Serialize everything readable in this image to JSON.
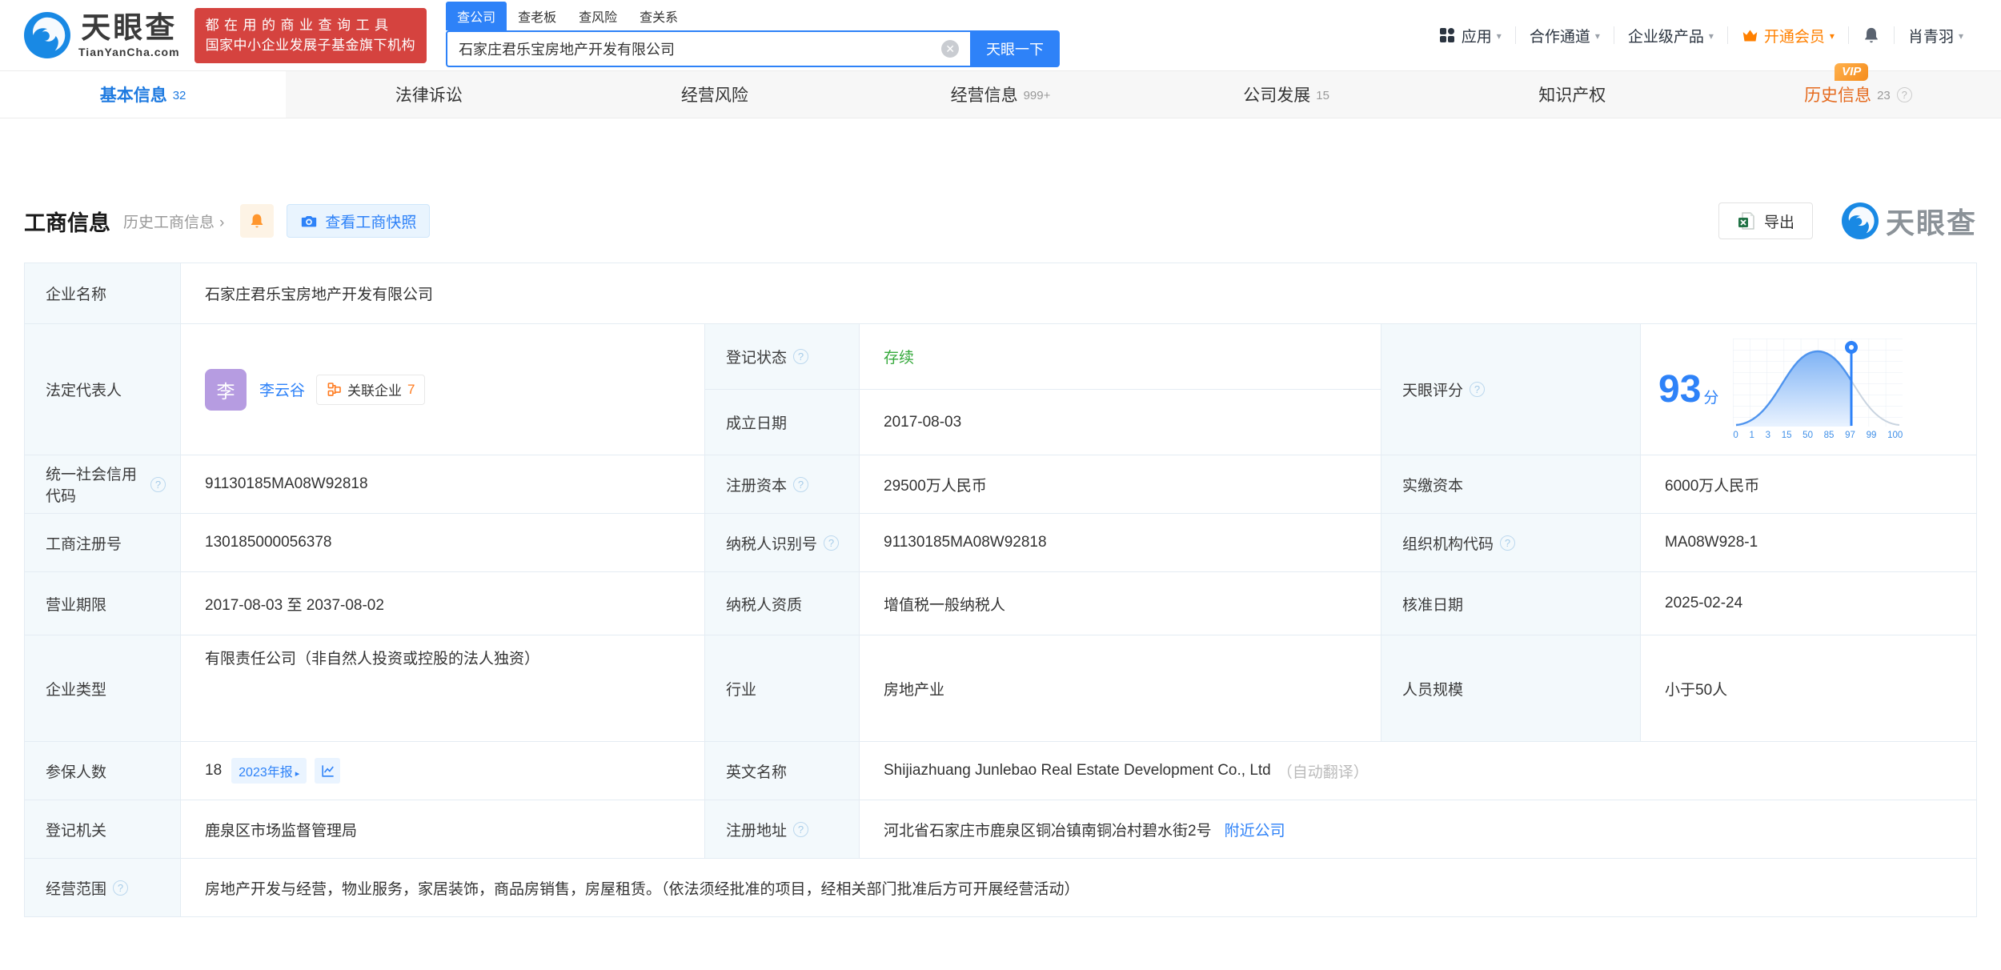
{
  "brand": {
    "name": "天眼查",
    "domain": "TianYanCha.com",
    "slogan_line1": "都在用的商业查询工具",
    "slogan_line2": "国家中小企业发展子基金旗下机构",
    "watermark": "天眼查"
  },
  "search": {
    "tabs": [
      "查公司",
      "查老板",
      "查风险",
      "查关系"
    ],
    "value": "石家庄君乐宝房地产开发有限公司",
    "submit": "天眼一下"
  },
  "nav": {
    "apps": "应用",
    "partner": "合作通道",
    "enterprise": "企业级产品",
    "vip": "开通会员",
    "username": "肖青羽"
  },
  "vip_badge": "VIP",
  "tabs": [
    {
      "label": "基本信息",
      "badge": "32"
    },
    {
      "label": "法律诉讼",
      "badge": ""
    },
    {
      "label": "经营风险",
      "badge": ""
    },
    {
      "label": "经营信息",
      "badge": "999+"
    },
    {
      "label": "公司发展",
      "badge": "15"
    },
    {
      "label": "知识产权",
      "badge": ""
    },
    {
      "label": "历史信息",
      "badge": "23"
    }
  ],
  "section": {
    "title": "工商信息",
    "history": "历史工商信息",
    "snapshot": "查看工商快照",
    "export": "导出"
  },
  "table": {
    "company_name": {
      "label": "企业名称",
      "value": "石家庄君乐宝房地产开发有限公司"
    },
    "legal_rep": {
      "label": "法定代表人",
      "avatar": "李",
      "name": "李云谷",
      "related_label": "关联企业",
      "related_count": "7"
    },
    "reg_status": {
      "label": "登记状态",
      "value": "存续"
    },
    "establish_date": {
      "label": "成立日期",
      "value": "2017-08-03"
    },
    "score": {
      "label": "天眼评分",
      "value": "93",
      "unit": "分",
      "axis": [
        "0",
        "1",
        "3",
        "15",
        "50",
        "85",
        "97",
        "99",
        "100"
      ]
    },
    "credit_code": {
      "label": "统一社会信用代码",
      "value": "91130185MA08W92818"
    },
    "reg_capital": {
      "label": "注册资本",
      "value": "29500万人民币"
    },
    "paid_capital": {
      "label": "实缴资本",
      "value": "6000万人民币"
    },
    "reg_number": {
      "label": "工商注册号",
      "value": "130185000056378"
    },
    "taxpayer_id": {
      "label": "纳税人识别号",
      "value": "91130185MA08W92818"
    },
    "org_code": {
      "label": "组织机构代码",
      "value": "MA08W928-1"
    },
    "business_term": {
      "label": "营业期限",
      "value": "2017-08-03 至 2037-08-02"
    },
    "taxpayer_quality": {
      "label": "纳税人资质",
      "value": "增值税一般纳税人"
    },
    "approve_date": {
      "label": "核准日期",
      "value": "2025-02-24"
    },
    "company_type": {
      "label": "企业类型",
      "value": "有限责任公司（非自然人投资或控股的法人独资）"
    },
    "industry": {
      "label": "行业",
      "value": "房地产业"
    },
    "staff_size": {
      "label": "人员规模",
      "value": "小于50人"
    },
    "insured_count": {
      "label": "参保人数",
      "value": "18",
      "report_badge": "2023年报"
    },
    "english_name": {
      "label": "英文名称",
      "value": "Shijiazhuang Junlebao Real Estate Development Co., Ltd",
      "suffix": "（自动翻译）"
    },
    "reg_authority": {
      "label": "登记机关",
      "value": "鹿泉区市场监督管理局"
    },
    "reg_address": {
      "label": "注册地址",
      "value": "河北省石家庄市鹿泉区铜冶镇南铜冶村碧水街2号",
      "nearby": "附近公司"
    },
    "business_scope": {
      "label": "经营范围",
      "value": "房地产开发与经营，物业服务，家居装饰，商品房销售，房屋租赁。（依法须经批准的项目，经相关部门批准后方可开展经营活动）"
    }
  }
}
